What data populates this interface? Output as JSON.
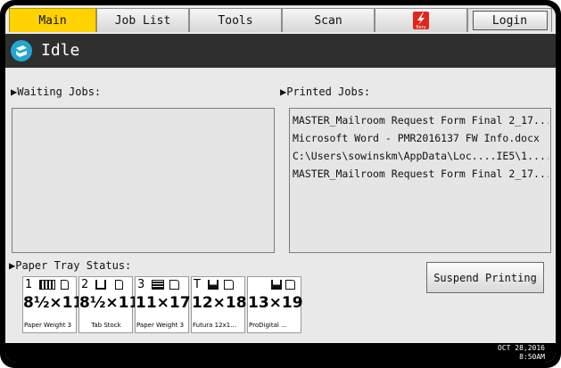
{
  "tabs": {
    "main": "Main",
    "job_list": "Job List",
    "tools": "Tools",
    "scan": "Scan",
    "login": "Login",
    "fiery_logo_text": "fiery"
  },
  "status": {
    "text": "Idle",
    "icon": "printer-status-icon"
  },
  "waiting_jobs": {
    "label": "▶Waiting Jobs:",
    "items": []
  },
  "printed_jobs": {
    "label": "▶Printed Jobs:",
    "items": [
      "MASTER_Mailroom Request Form Final 2_17...",
      "Microsoft Word - PMR2016137 FW Info.docx",
      "C:\\Users\\sowinskm\\AppData\\Loc....IE5\\1....",
      "MASTER_Mailroom Request Form Final 2_17..."
    ]
  },
  "paper_tray_status": {
    "label": "▶Paper Tray Status:",
    "trays": [
      {
        "id": "1",
        "size": "8½×11",
        "type": "Paper Weight 3"
      },
      {
        "id": "2",
        "size": "8½×11",
        "type": "Tab Stock"
      },
      {
        "id": "3",
        "size": "11×17",
        "type": "Paper Weight 3"
      },
      {
        "id": "T",
        "size": "12×18",
        "type": "Futura 12x1…"
      },
      {
        "id": "",
        "size": "13×19",
        "type": "ProDigital …"
      }
    ]
  },
  "suspend_button": "Suspend Printing",
  "footer": {
    "date": "OCT  28,2016",
    "time": "8:50AM"
  },
  "colors": {
    "active_tab": "#ffd200",
    "header_bg": "#2f2f2f",
    "status_icon": "#22a7cf"
  }
}
